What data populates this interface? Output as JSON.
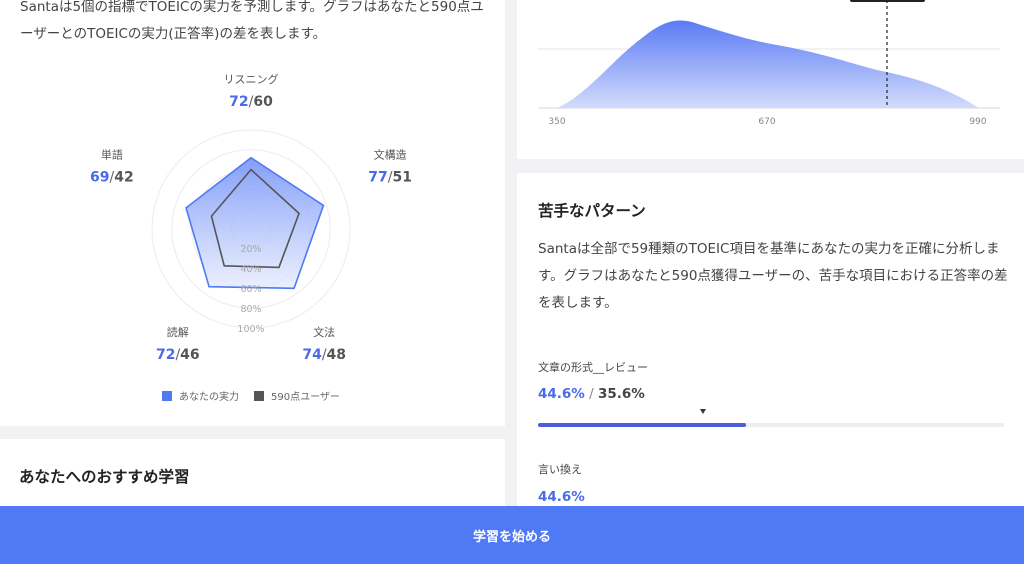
{
  "radar_card": {
    "description_line1": "Santaは5個の指標でTOEICの実力を予測します。グラフはあなたと590点ユ",
    "description_line2": "ーザーとのTOEICの実力(正答率)の差を表します。",
    "axes": [
      {
        "label": "リスニング",
        "you": 72,
        "other": 60
      },
      {
        "label": "文構造",
        "you": 77,
        "other": 51
      },
      {
        "label": "文法",
        "you": 74,
        "other": 48
      },
      {
        "label": "読解",
        "you": 72,
        "other": 46
      },
      {
        "label": "単語",
        "you": 69,
        "other": 42
      }
    ],
    "ring_labels": [
      "20%",
      "40%",
      "60%",
      "80%",
      "100%"
    ],
    "legend": {
      "you": "あなたの実力",
      "other": "590点ユーザー"
    },
    "colors": {
      "you": "#5079f6",
      "other": "#555555",
      "you_text": "#4a6be8",
      "other_text": "#555555"
    }
  },
  "distribution_card": {
    "ticks": [
      "350",
      "670",
      "990"
    ]
  },
  "weak_card": {
    "title": "苦手なパターン",
    "description_line1": "Santaは全部で59種類のTOEIC項目を基準にあなたの実力を正確に分析しま",
    "description_line2": "す。グラフはあなたと590点獲得ユーザーの、苦手な項目における正答率の差",
    "description_line3": "を表します。",
    "items": [
      {
        "label": "文章の形式__レビュー",
        "you": "44.6%",
        "separator": " / ",
        "other": "35.6%",
        "you_value": 44.6,
        "other_value": 35.6
      },
      {
        "label": "言い換え",
        "you": "44.6%"
      }
    ]
  },
  "recommend_card": {
    "title": "あなたへのおすすめ学習"
  },
  "cta": {
    "label": "学習を始める"
  }
}
